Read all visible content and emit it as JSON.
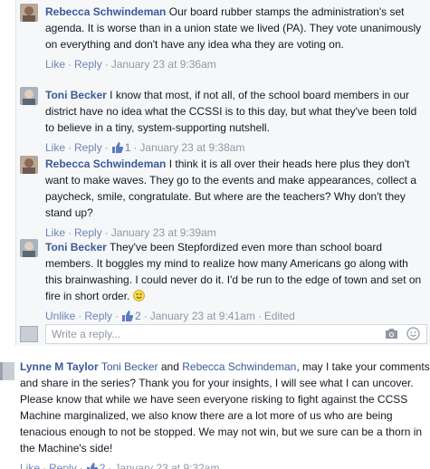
{
  "replies": [
    {
      "author": "Rebecca Schwindeman",
      "text": "Our board rubber stamps the administration's set agenda. It is worse than in a union state we lived (PA). They vote unanimously on everything and don't have any idea wha they are voting on.",
      "like_label": "Like",
      "reply_label": "Reply",
      "timestamp": "January 23 at 9:36am"
    },
    {
      "author": "Toni Becker",
      "text": "I know that most, if not all, of the school board members in our district have no idea what the CCSSI is to this day, but what they've been told to believe in a tiny, system-supporting nutshell.",
      "like_label": "Like",
      "reply_label": "Reply",
      "like_count": "1",
      "timestamp": "January 23 at 9:38am"
    },
    {
      "author": "Rebecca Schwindeman",
      "text": "I think it is all over their heads here plus they don't want to make waves. They go to the events and make appearances, collect a paycheck, smile, congratulate. But where are the teachers? Why don't they stand up?",
      "like_label": "Like",
      "reply_label": "Reply",
      "timestamp": "January 23 at 9:39am"
    },
    {
      "author": "Toni Becker",
      "text": "They've been Stepfordized even more than school board members. It boggles my mind to realize how many Americans go along with this brainwashing. I could never do it. I'd be run to the edge of town and set on fire in short order.",
      "like_label": "Unlike",
      "reply_label": "Reply",
      "like_count": "2",
      "timestamp": "January 23 at 9:41am",
      "edited_label": "Edited"
    }
  ],
  "write_reply": {
    "placeholder": "Write a reply..."
  },
  "toplevel": {
    "author": "Lynne M Taylor",
    "mention1": "Toni Becker",
    "and_word": "and",
    "mention2": "Rebecca Schwindeman",
    "text": ", may I take your comments and share in the series? Thank you for your insights, I will see what I can uncover. Please know that while we have seen everyone risking to fight against the CCSS Machine marginalized, we also know there are a lot more of us who are being tenacious enough to not be stopped. We may not win, but we sure can be a thorn in the Machine's side!",
    "like_label": "Like",
    "reply_label": "Reply",
    "like_count": "2",
    "timestamp": "January 23 at 9:32am"
  },
  "colors": {
    "link": "#3b5998",
    "action": "#6d84b4",
    "meta": "#9197a3",
    "thread_bg": "#f6f7f9"
  },
  "icons": [
    "thumbs-up-icon",
    "camera-icon",
    "smiley-icon"
  ]
}
